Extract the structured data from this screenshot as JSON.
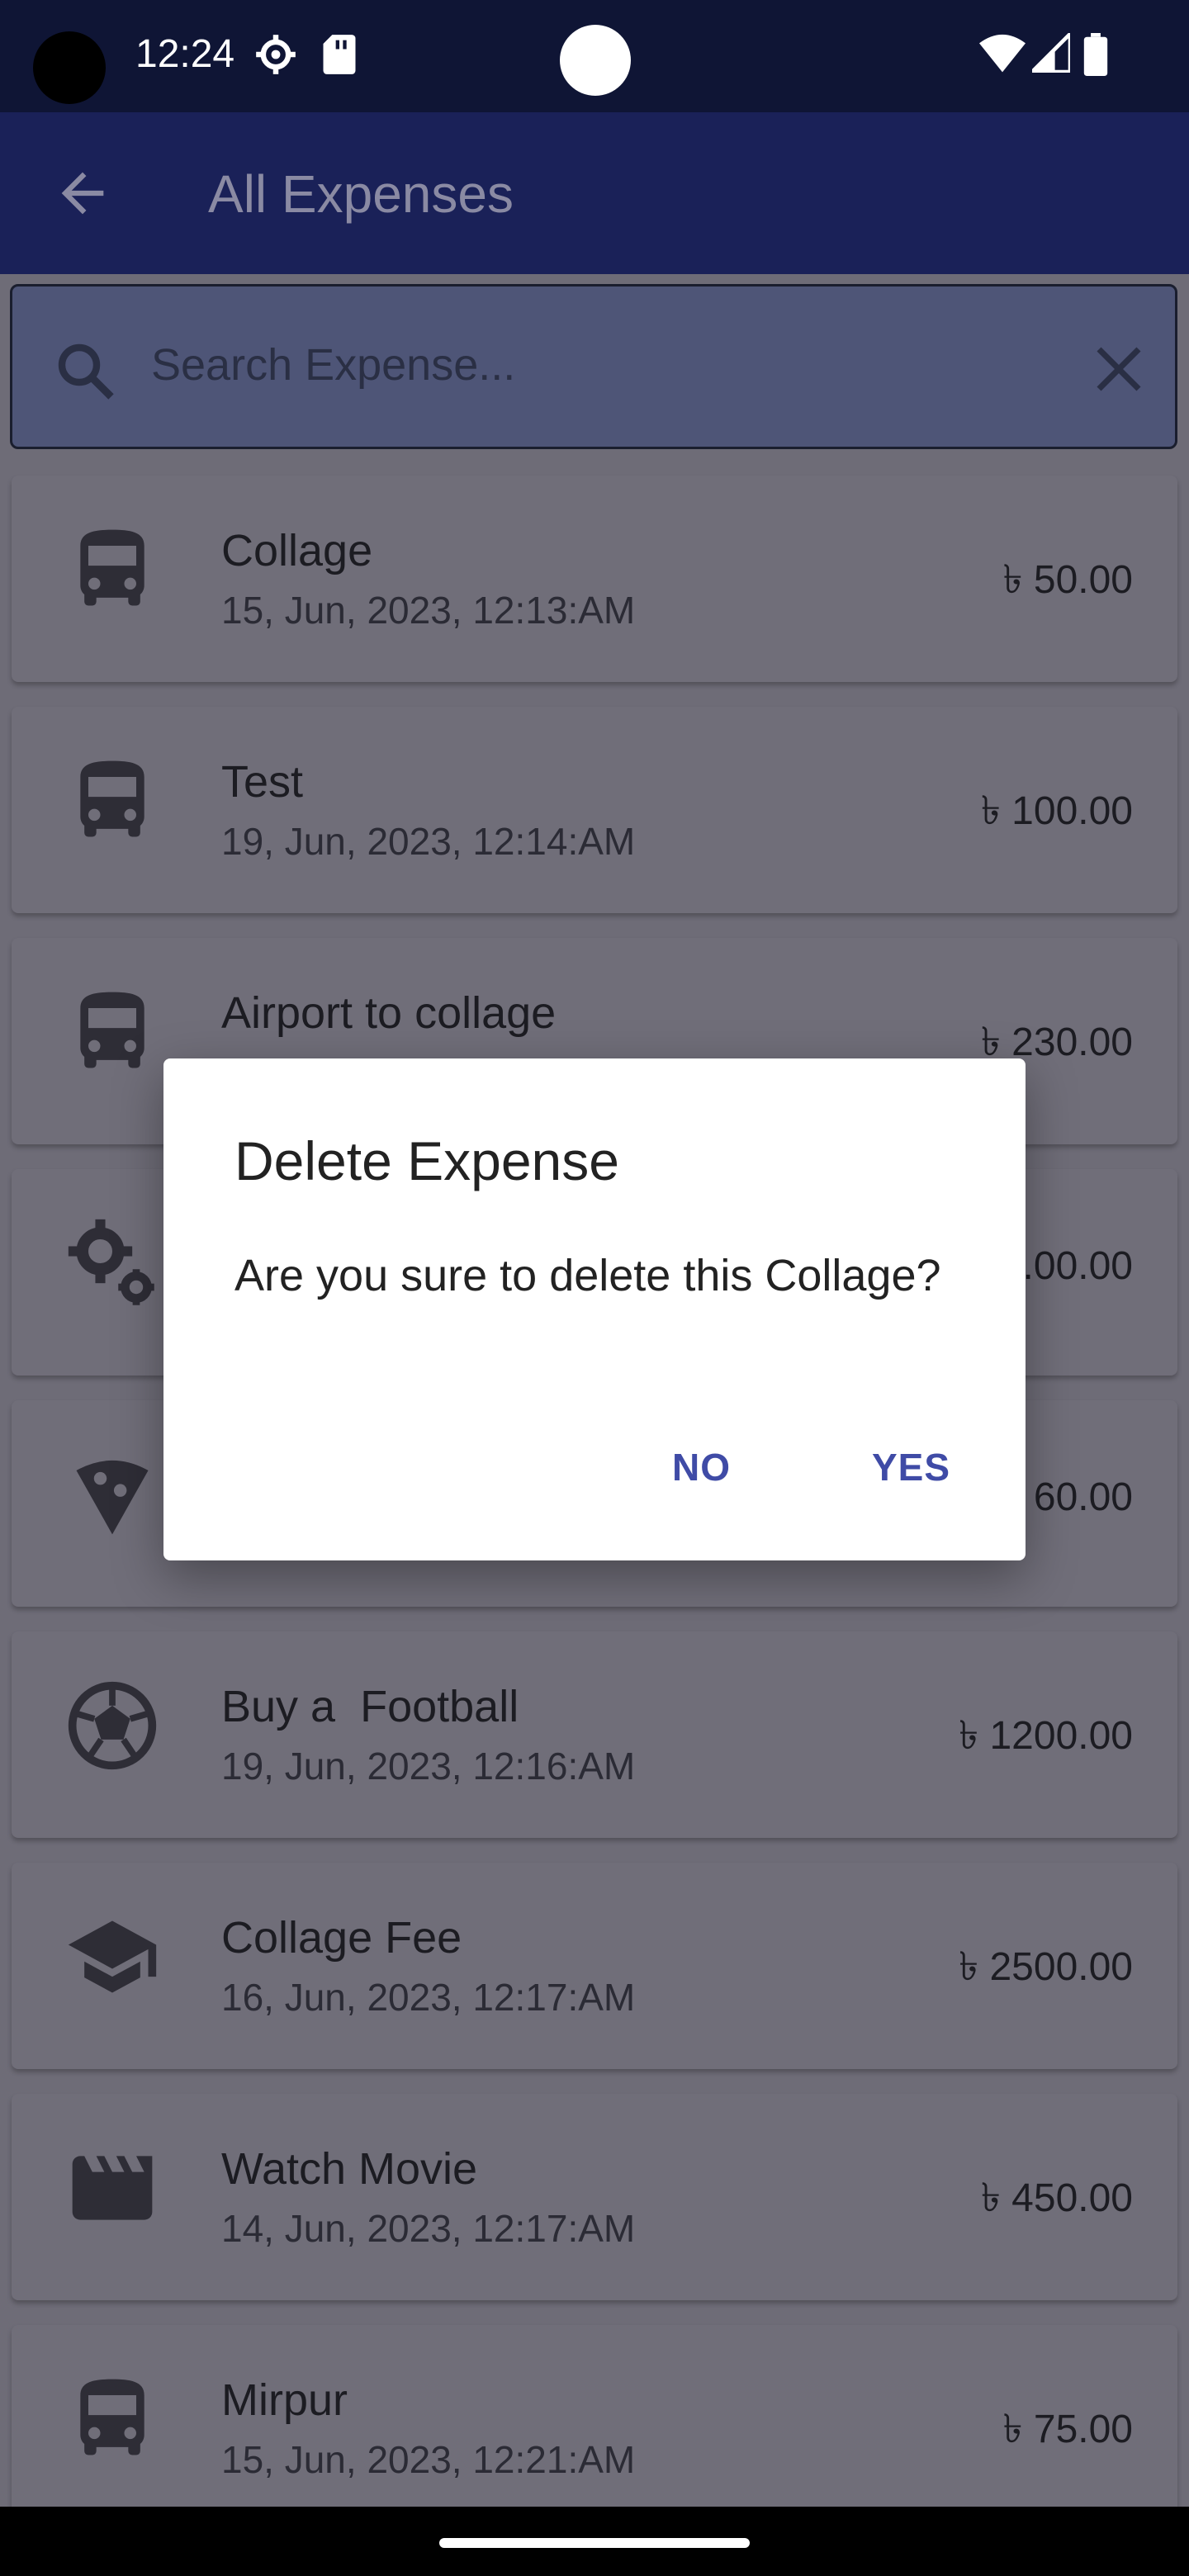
{
  "status_bar": {
    "time": "12:24",
    "icons": [
      "camera-cutout-icon",
      "settings-gear-icon",
      "sd-card-icon",
      "wifi-icon",
      "signal-icon",
      "battery-icon"
    ]
  },
  "app_bar": {
    "title": "All Expenses",
    "back_icon": "arrow-back-icon"
  },
  "search": {
    "placeholder": "Search Expense...",
    "icon": "search-icon",
    "clear_icon": "close-icon"
  },
  "expenses": [
    {
      "title": "Collage",
      "date": "15, Jun, 2023, 12:13:AM",
      "amount": "৳ 50.00",
      "icon": "bus-icon"
    },
    {
      "title": "Test",
      "date": "19, Jun, 2023, 12:14:AM",
      "amount": "৳ 100.00",
      "icon": "bus-icon"
    },
    {
      "title": "Airport to collage",
      "date": "",
      "amount": "৳ 230.00",
      "icon": "bus-icon"
    },
    {
      "title": "",
      "date": "",
      "amount": ".00.00",
      "icon": "gears-icon"
    },
    {
      "title": "",
      "date": "",
      "amount": "60.00",
      "icon": "pizza-icon"
    },
    {
      "title": "Buy a  Football",
      "date": "19, Jun, 2023, 12:16:AM",
      "amount": "৳ 1200.00",
      "icon": "football-icon"
    },
    {
      "title": "Collage Fee",
      "date": "16, Jun, 2023, 12:17:AM",
      "amount": "৳ 2500.00",
      "icon": "graduation-cap-icon"
    },
    {
      "title": "Watch Movie",
      "date": "14, Jun, 2023, 12:17:AM",
      "amount": "৳ 450.00",
      "icon": "movie-clapper-icon"
    },
    {
      "title": "Mirpur",
      "date": "15, Jun, 2023, 12:21:AM",
      "amount": "৳ 75.00",
      "icon": "bus-icon"
    }
  ],
  "dialog": {
    "title": "Delete Expense",
    "message": "Are you sure to delete this Collage?",
    "no_label": "NO",
    "yes_label": "YES"
  },
  "colors": {
    "status_bar": "#0f1535",
    "app_bar": "#1a2158",
    "dialog_button": "#3f4ba6"
  }
}
